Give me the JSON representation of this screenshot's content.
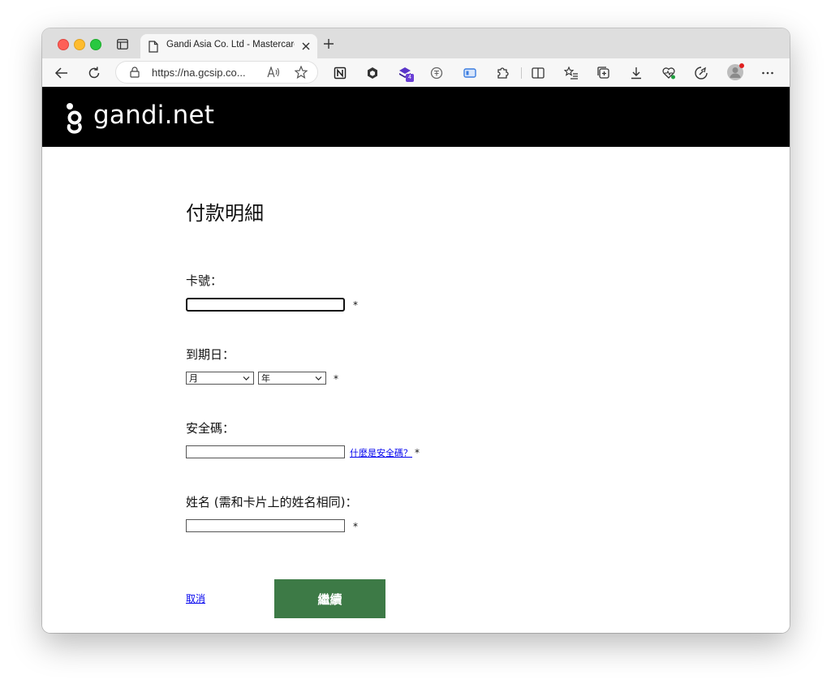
{
  "browser": {
    "tab": {
      "title": "Gandi Asia Co. Ltd - Mastercard"
    },
    "url": "https://na.gcsip.co...",
    "extension_badge": "4"
  },
  "site": {
    "logo_text": "gandi.net"
  },
  "form": {
    "title": "付款明細",
    "card_number": {
      "label": "卡號：",
      "value": "",
      "required_mark": "*"
    },
    "expiry": {
      "label": "到期日：",
      "month_selected": "月",
      "year_selected": "年",
      "required_mark": "*"
    },
    "security_code": {
      "label": "安全碼：",
      "value": "",
      "help_link": "什麼是安全碼？",
      "required_mark": "*"
    },
    "name": {
      "label": "姓名 (需和卡片上的姓名相同)：",
      "value": "",
      "required_mark": "*"
    },
    "cancel_label": "取消",
    "continue_label": "繼續"
  },
  "colors": {
    "header_bg": "#000000",
    "button_green": "#3d7a46",
    "link_blue": "#0000ee"
  }
}
